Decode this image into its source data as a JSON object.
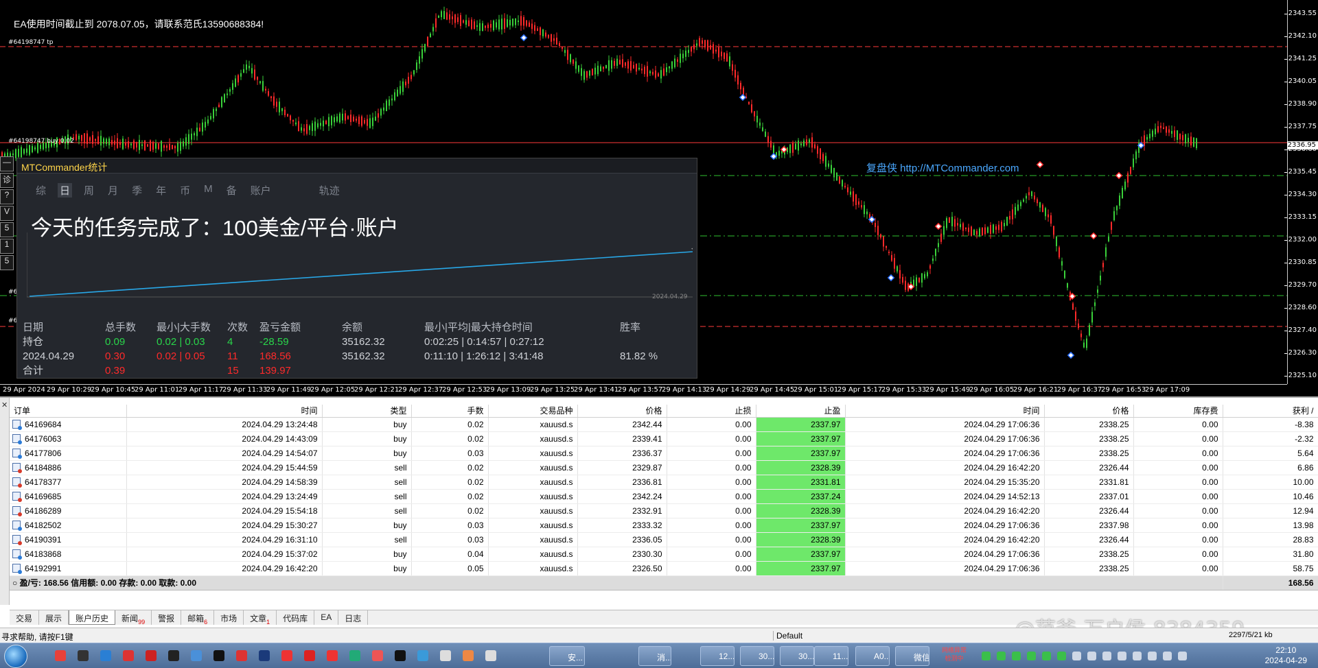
{
  "chart": {
    "ea_notice": "EA使用时间截止到 2078.07.05，请联系范氏13590688384!",
    "order_tp_label": "#64198747 tp",
    "order_buy_label": "#64198747 buy 0.02",
    "order_label_short": "#64",
    "watermark": "复盘侠 http://MTCommander.com",
    "current_price": "2336.95",
    "price_ticks": [
      "2343.55",
      "2342.10",
      "2341.25",
      "2340.05",
      "2338.90",
      "2337.75",
      "2336.60",
      "2335.45",
      "2334.30",
      "2333.15",
      "2332.00",
      "2330.85",
      "2329.70",
      "2328.60",
      "2327.40",
      "2326.30",
      "2325.10"
    ],
    "time_ticks": [
      "29 Apr 2024",
      "29 Apr 10:29",
      "29 Apr 10:45",
      "29 Apr 11:01",
      "29 Apr 11:17",
      "29 Apr 11:33",
      "29 Apr 11:49",
      "29 Apr 12:05",
      "29 Apr 12:21",
      "29 Apr 12:37",
      "29 Apr 12:53",
      "29 Apr 13:09",
      "29 Apr 13:25",
      "29 Apr 13:41",
      "29 Apr 13:57",
      "29 Apr 14:13",
      "29 Apr 14:29",
      "29 Apr 14:45",
      "29 Apr 15:01",
      "29 Apr 15:17",
      "29 Apr 15:33",
      "29 Apr 15:49",
      "29 Apr 16:05",
      "29 Apr 16:21",
      "29 Apr 16:37",
      "29 Apr 16:53",
      "29 Apr 17:09"
    ],
    "colors": {
      "bull": "#3ad13a",
      "bear": "#ff2a2a",
      "tp_line": "#ff3a3a",
      "level_line": "#2fc22f",
      "background": "#000000"
    }
  },
  "left_tools": [
    "—",
    "诊",
    "?",
    "V",
    "5",
    "1",
    "5"
  ],
  "mtc": {
    "title": "MTCommander统计",
    "tabs": [
      "综",
      "日",
      "周",
      "月",
      "季",
      "年",
      "币",
      "M",
      "备",
      "账户",
      "轨迹"
    ],
    "active_tab": "日",
    "headline": "今天的任务完成了：100美金/平台·账户",
    "mini_date": "2024.04.29",
    "stats_headers": [
      "日期",
      "总手数",
      "最小|大手数",
      "次数",
      "盈亏金额",
      "余额",
      "最小|平均|最大持仓时间",
      "胜率"
    ],
    "stats_rows": [
      {
        "cells": [
          "持仓",
          "0.09",
          "0.02 | 0.03",
          "4",
          "-28.59",
          "35162.32",
          "0:02:25 | 0:14:57 | 0:27:12",
          ""
        ],
        "tone": [
          "w",
          "g",
          "g",
          "g",
          "g",
          "w",
          "w",
          "w"
        ]
      },
      {
        "cells": [
          "2024.04.29",
          "0.30",
          "0.02 | 0.05",
          "11",
          "168.56",
          "35162.32",
          "0:11:10 | 1:26:12 | 3:41:48",
          "81.82 %"
        ],
        "tone": [
          "w",
          "r",
          "r",
          "r",
          "r",
          "w",
          "w",
          "w"
        ]
      },
      {
        "cells": [
          "合计",
          "0.39",
          "",
          "15",
          "139.97",
          "",
          "",
          ""
        ],
        "tone": [
          "w",
          "r",
          "r",
          "r",
          "r",
          "w",
          "w",
          "w"
        ]
      }
    ]
  },
  "table": {
    "headers": [
      "订单",
      "时间",
      "类型",
      "手数",
      "交易品种",
      "价格",
      "止损",
      "止盈",
      "时间",
      "价格",
      "库存费",
      "获利 /"
    ],
    "rows": [
      [
        "64169684",
        "2024.04.29 13:24:48",
        "buy",
        "0.02",
        "xauusd.s",
        "2342.44",
        "0.00",
        "2337.97",
        "2024.04.29 17:06:36",
        "2338.25",
        "0.00",
        "-8.38"
      ],
      [
        "64176063",
        "2024.04.29 14:43:09",
        "buy",
        "0.02",
        "xauusd.s",
        "2339.41",
        "0.00",
        "2337.97",
        "2024.04.29 17:06:36",
        "2338.25",
        "0.00",
        "-2.32"
      ],
      [
        "64177806",
        "2024.04.29 14:54:07",
        "buy",
        "0.03",
        "xauusd.s",
        "2336.37",
        "0.00",
        "2337.97",
        "2024.04.29 17:06:36",
        "2338.25",
        "0.00",
        "5.64"
      ],
      [
        "64184886",
        "2024.04.29 15:44:59",
        "sell",
        "0.02",
        "xauusd.s",
        "2329.87",
        "0.00",
        "2328.39",
        "2024.04.29 16:42:20",
        "2326.44",
        "0.00",
        "6.86"
      ],
      [
        "64178377",
        "2024.04.29 14:58:39",
        "sell",
        "0.02",
        "xauusd.s",
        "2336.81",
        "0.00",
        "2331.81",
        "2024.04.29 15:35:20",
        "2331.81",
        "0.00",
        "10.00"
      ],
      [
        "64169685",
        "2024.04.29 13:24:49",
        "sell",
        "0.02",
        "xauusd.s",
        "2342.24",
        "0.00",
        "2337.24",
        "2024.04.29 14:52:13",
        "2337.01",
        "0.00",
        "10.46"
      ],
      [
        "64186289",
        "2024.04.29 15:54:18",
        "sell",
        "0.02",
        "xauusd.s",
        "2332.91",
        "0.00",
        "2328.39",
        "2024.04.29 16:42:20",
        "2326.44",
        "0.00",
        "12.94"
      ],
      [
        "64182502",
        "2024.04.29 15:30:27",
        "buy",
        "0.03",
        "xauusd.s",
        "2333.32",
        "0.00",
        "2337.97",
        "2024.04.29 17:06:36",
        "2337.98",
        "0.00",
        "13.98"
      ],
      [
        "64190391",
        "2024.04.29 16:31:10",
        "sell",
        "0.03",
        "xauusd.s",
        "2336.05",
        "0.00",
        "2328.39",
        "2024.04.29 16:42:20",
        "2326.44",
        "0.00",
        "28.83"
      ],
      [
        "64183868",
        "2024.04.29 15:37:02",
        "buy",
        "0.04",
        "xauusd.s",
        "2330.30",
        "0.00",
        "2337.97",
        "2024.04.29 17:06:36",
        "2338.25",
        "0.00",
        "31.80"
      ],
      [
        "64192991",
        "2024.04.29 16:42:20",
        "buy",
        "0.05",
        "xauusd.s",
        "2326.50",
        "0.00",
        "2337.97",
        "2024.04.29 17:06:36",
        "2338.25",
        "0.00",
        "58.75"
      ]
    ],
    "summary": {
      "text": "盈/亏: 168.56  信用额: 0.00  存款: 0.00  取款: 0.00",
      "total": "168.56"
    }
  },
  "term_tabs": [
    {
      "label": "交易",
      "badge": ""
    },
    {
      "label": "展示",
      "badge": ""
    },
    {
      "label": "账户历史",
      "badge": "",
      "active": true
    },
    {
      "label": "新闻",
      "badge": "99"
    },
    {
      "label": "警报",
      "badge": ""
    },
    {
      "label": "邮箱",
      "badge": "6"
    },
    {
      "label": "市场",
      "badge": ""
    },
    {
      "label": "文章",
      "badge": "1"
    },
    {
      "label": "代码库",
      "badge": ""
    },
    {
      "label": "EA",
      "badge": ""
    },
    {
      "label": "日志",
      "badge": ""
    }
  ],
  "status": {
    "help": "寻求帮助, 请按F1键",
    "profile": "Default",
    "conn": "2297/5/21 kb"
  },
  "weibo": "@范爷-万户侯-8384359",
  "taskbar": {
    "tasks": [
      "安...",
      "消...",
      "12...",
      "30...",
      "30...",
      "11...",
      "A0...",
      "微信"
    ],
    "warn": "网络异常\n检测中",
    "time": "22:10",
    "date": "2024-04-29"
  }
}
